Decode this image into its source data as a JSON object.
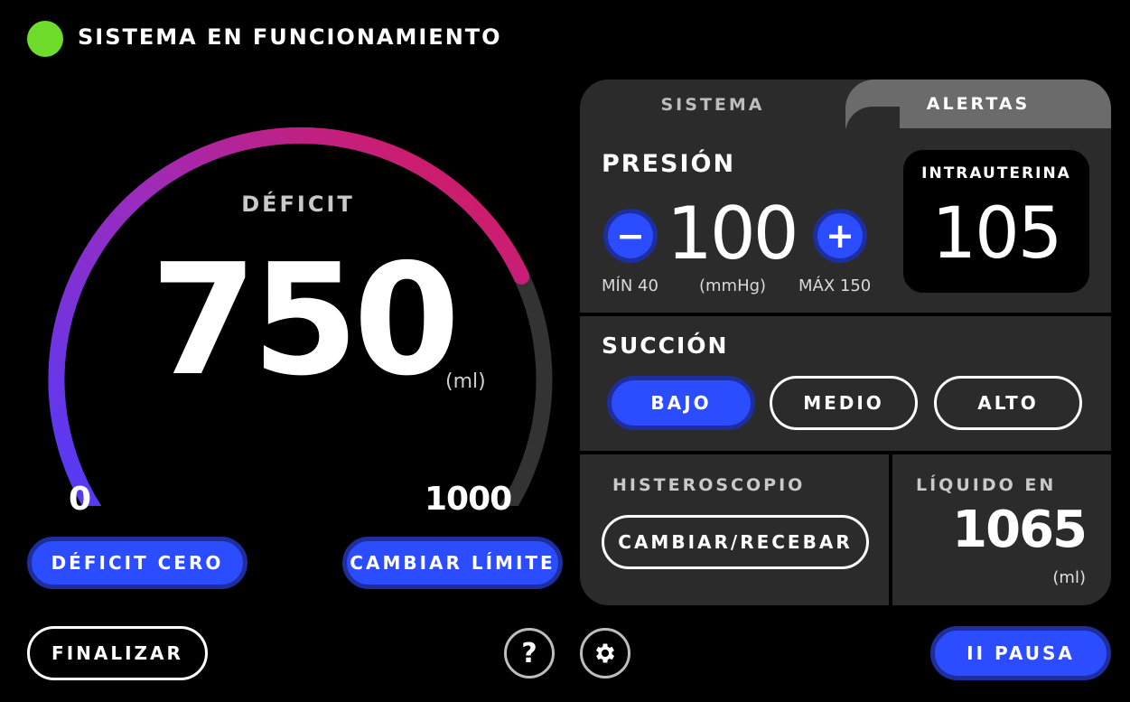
{
  "status": {
    "text": "SISTEMA EN FUNCIONAMIENTO",
    "color": "#6fdc2b"
  },
  "gauge": {
    "label": "DÉFICIT",
    "value": "750",
    "unit": "(ml)",
    "min_label": "0",
    "max_label": "1000",
    "fraction": 0.75,
    "colors": {
      "start": "#4a3cff",
      "mid": "#9a2bbf",
      "end": "#e0174f",
      "track": "#333333"
    }
  },
  "buttons": {
    "deficit_zero": "DÉFICIT CERO",
    "change_limit": "CAMBIAR LÍMITE",
    "finish": "FINALIZAR",
    "pause": "II PAUSA"
  },
  "tabs": {
    "system": "SISTEMA",
    "alerts": "ALERTAS"
  },
  "pressure": {
    "title": "PRESIÓN",
    "value": "100",
    "minus": "−",
    "plus": "+",
    "min_label": "MÍN 40",
    "unit": "(mmHg)",
    "max_label": "MÁX 150",
    "intrauterine_label": "INTRAUTERINA",
    "intrauterine_value": "105"
  },
  "suction": {
    "title": "SUCCIÓN",
    "options": [
      "BAJO",
      "MEDIO",
      "ALTO"
    ],
    "selected": "BAJO"
  },
  "hysteroscope": {
    "label": "HISTEROSCOPIO",
    "button": "CAMBIAR/RECEBAR"
  },
  "fluid_in": {
    "label": "LÍQUIDO EN",
    "value": "1065",
    "unit": "(ml)"
  },
  "icons": {
    "help": "?",
    "settings": "gear-icon"
  },
  "accent": "#2b4cff"
}
